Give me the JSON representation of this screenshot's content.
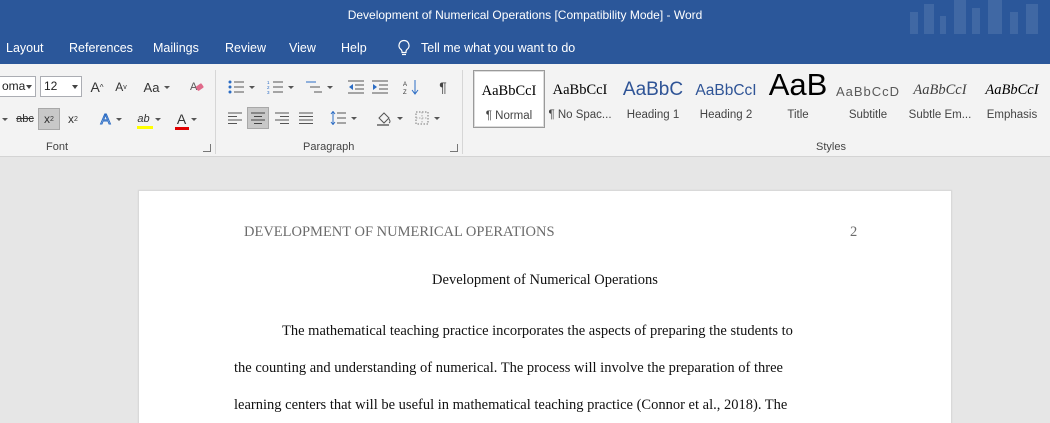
{
  "window": {
    "title": "Development of Numerical Operations [Compatibility Mode]  -  Word"
  },
  "tabs": [
    "Layout",
    "References",
    "Mailings",
    "Review",
    "View",
    "Help"
  ],
  "tell_me": "Tell me what you want to do",
  "font_group": {
    "label": "Font",
    "font_name": "oma",
    "font_size": "12",
    "change_case": "Aa",
    "strikethrough": "abc",
    "subscript": "x",
    "subscript_mark": "2",
    "superscript": "x",
    "superscript_mark": "2",
    "grow_label": "A",
    "shrink_label": "A",
    "effects_label": "A",
    "highlight_label": "ab",
    "font_color_label": "A",
    "highlight_color": "#ffff00",
    "font_color": "#e00000"
  },
  "paragraph_group": {
    "label": "Paragraph",
    "pilcrow": "¶"
  },
  "styles_group": {
    "label": "Styles",
    "items": [
      {
        "preview": "AaBbCcI",
        "name": "¶ Normal"
      },
      {
        "preview": "AaBbCcI",
        "name": "¶ No Spac..."
      },
      {
        "preview": "AaBbC",
        "name": "Heading 1"
      },
      {
        "preview": "AaBbCcI",
        "name": "Heading 2"
      },
      {
        "preview": "AaB",
        "name": "Title"
      },
      {
        "preview": "AaBbCcD",
        "name": "Subtitle"
      },
      {
        "preview": "AaBbCcI",
        "name": "Subtle Em..."
      },
      {
        "preview": "AaBbCcI",
        "name": "Emphasis"
      }
    ]
  },
  "document": {
    "header": "DEVELOPMENT OF NUMERICAL OPERATIONS",
    "page_number": "2",
    "title": "Development of Numerical Operations",
    "lines": [
      "The mathematical teaching practice incorporates the aspects of preparing the students to",
      "the counting and understanding of numerical. The process will involve the preparation of three",
      "learning centers that will be useful in mathematical teaching practice (Connor et al., 2018). The"
    ]
  },
  "colors": {
    "title_bar": "#2b579a",
    "ribbon": "#f3f3f3",
    "canvas": "#e6e6e6"
  }
}
